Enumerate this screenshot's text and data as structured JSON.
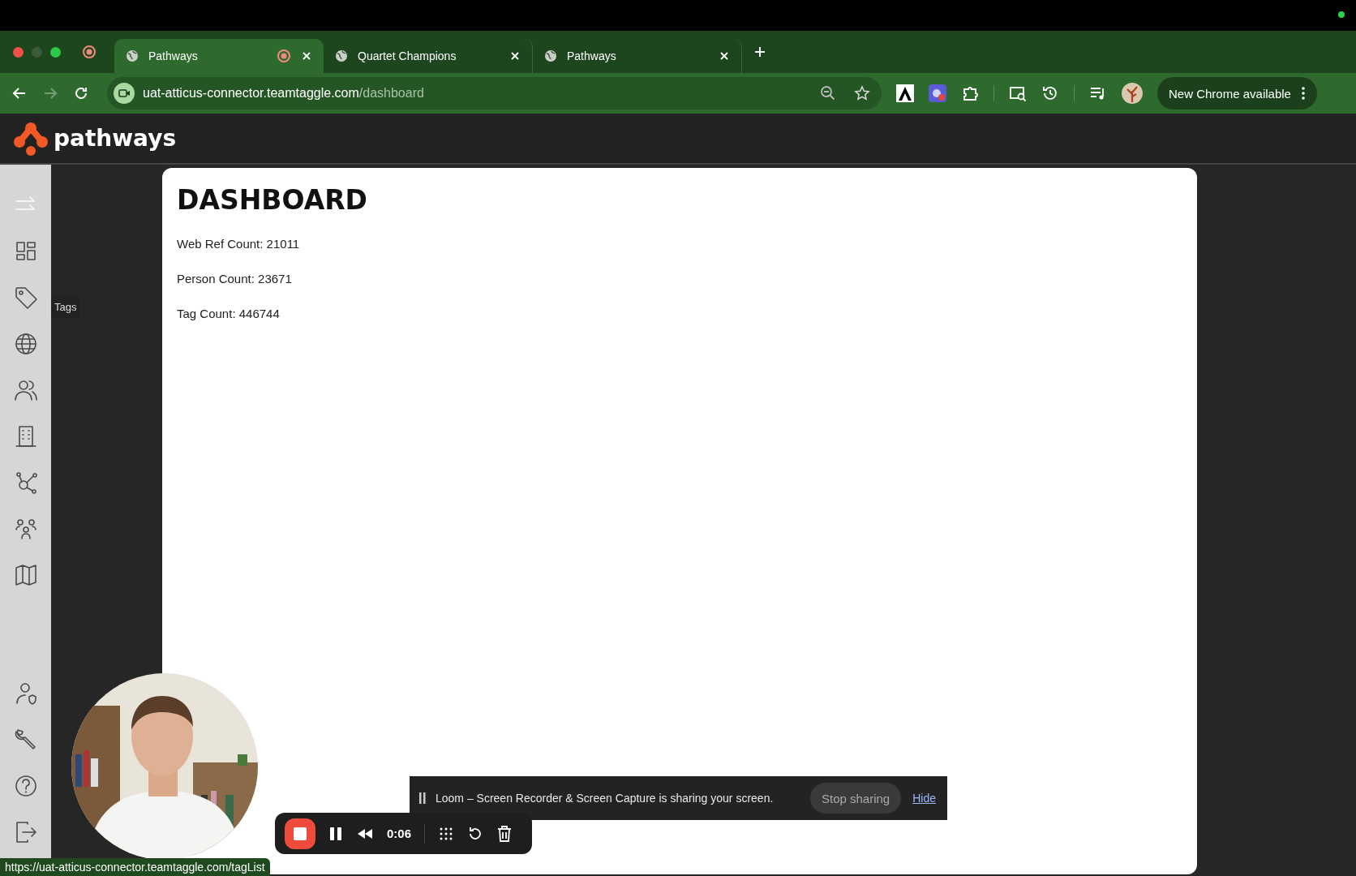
{
  "browser": {
    "tabs": [
      {
        "title": "Pathways",
        "selected": true,
        "recording": true
      },
      {
        "title": "Quartet Champions",
        "selected": false,
        "recording": false
      },
      {
        "title": "Pathways",
        "selected": false,
        "recording": false
      }
    ],
    "address": {
      "host": "uat-atticus-connector.teamtaggle.com",
      "path": "/dashboard"
    },
    "update_button": "New Chrome available"
  },
  "app": {
    "logo": "pathways",
    "sidebar": {
      "top": [
        {
          "kind": "arrows"
        },
        {
          "kind": "grid"
        },
        {
          "kind": "tag"
        },
        {
          "kind": "globe"
        },
        {
          "kind": "people"
        },
        {
          "kind": "building"
        },
        {
          "kind": "network"
        },
        {
          "kind": "group"
        },
        {
          "kind": "map"
        }
      ],
      "bottom": [
        {
          "kind": "user-shield"
        },
        {
          "kind": "wrench"
        },
        {
          "kind": "help"
        },
        {
          "kind": "logout"
        }
      ]
    },
    "tooltip": "Tags"
  },
  "dashboard": {
    "title": "DASHBOARD",
    "stats": [
      "Web Ref Count: 21011",
      "Person Count: 23671",
      "Tag Count: 446744"
    ]
  },
  "loom": {
    "message": "Loom – Screen Recorder & Screen Capture is sharing your screen.",
    "stop_button": "Stop sharing",
    "hide_link": "Hide",
    "timer": "0:06"
  },
  "status_url": "https://uat-atticus-connector.teamtaggle.com/tagList"
}
